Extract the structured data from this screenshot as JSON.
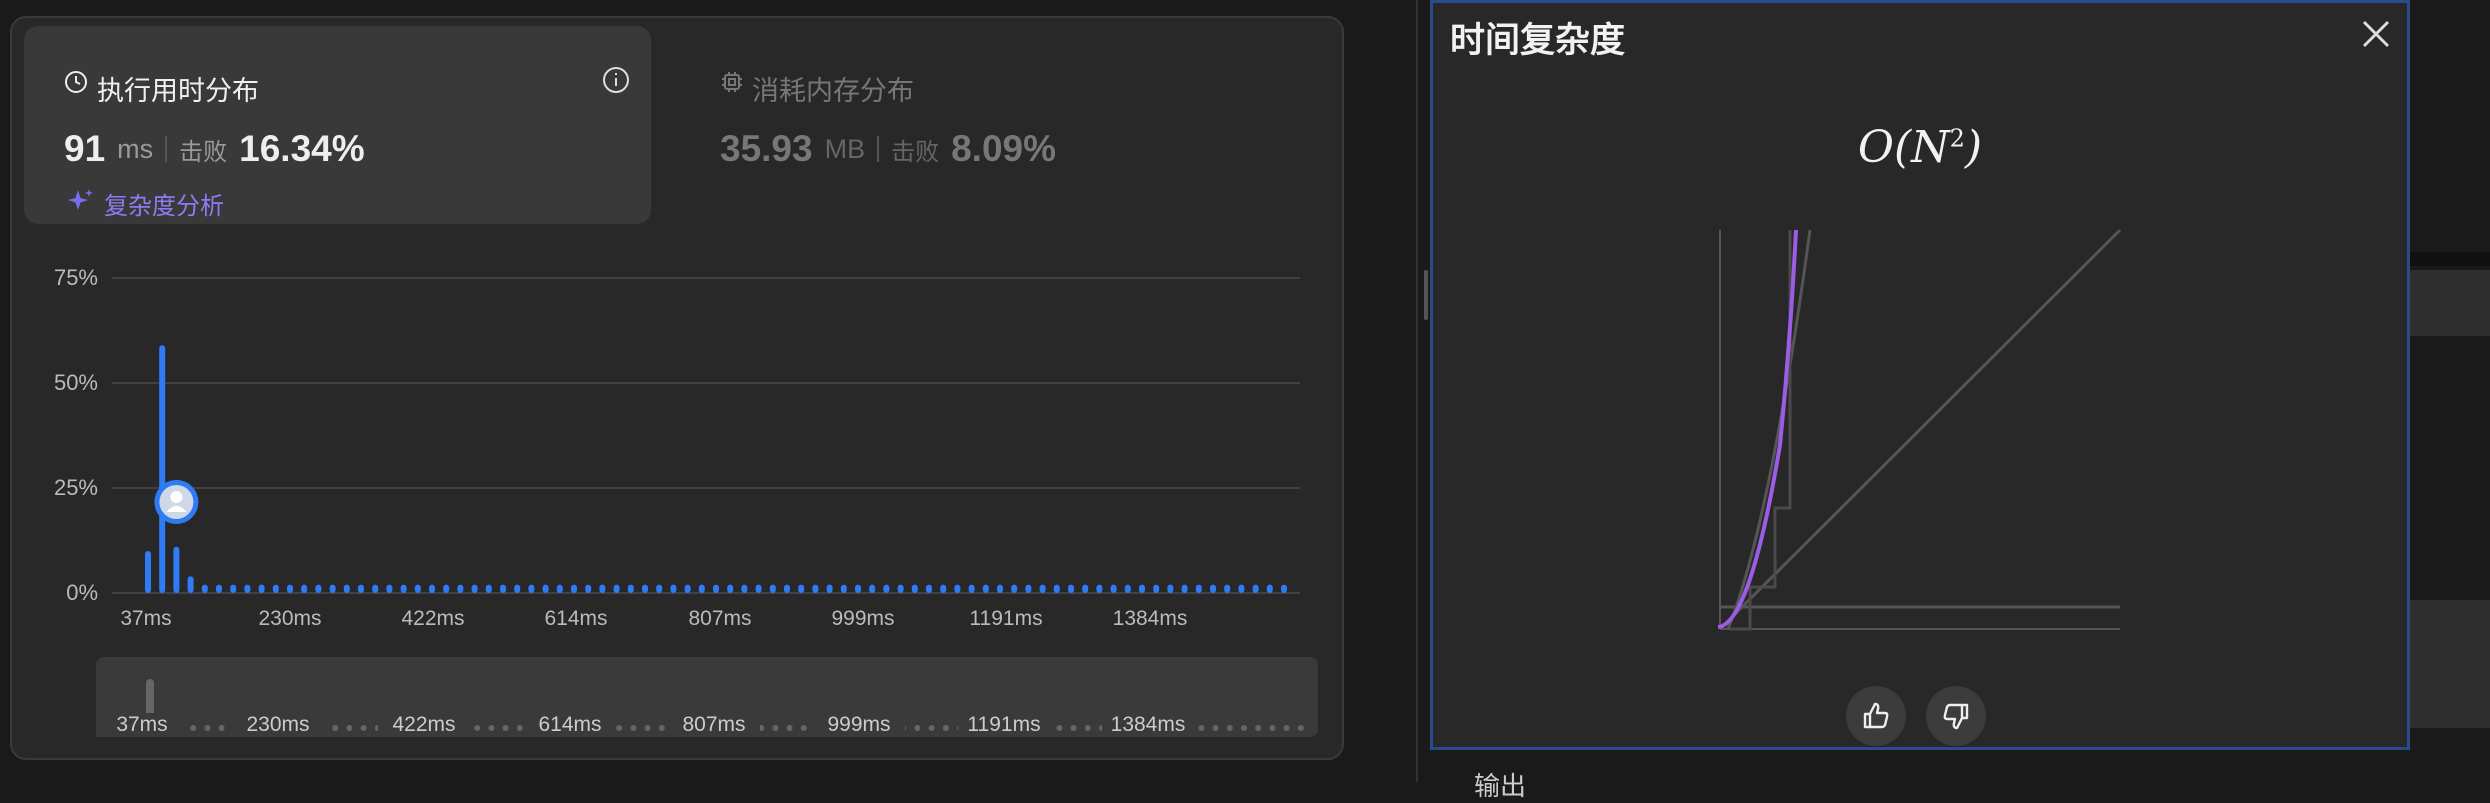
{
  "runtime": {
    "title": "执行用时分布",
    "value": "91",
    "unit": "ms",
    "beats_label": "击败",
    "beats_value": "16.34%",
    "analysis_link": "复杂度分析"
  },
  "memory": {
    "title": "消耗内存分布",
    "value": "35.93",
    "unit": "MB",
    "beats_label": "击败",
    "beats_value": "8.09%"
  },
  "chart_data": {
    "type": "bar",
    "y_ticks": [
      "75%",
      "50%",
      "25%",
      "0%"
    ],
    "x_ticks": [
      "37ms",
      "230ms",
      "422ms",
      "614ms",
      "807ms",
      "999ms",
      "1191ms",
      "1384ms"
    ],
    "ylim": [
      0,
      75
    ],
    "values": [
      10,
      59,
      11,
      4,
      2,
      2,
      2,
      2,
      2,
      2,
      2,
      2,
      2,
      2,
      2,
      2,
      2,
      2,
      2,
      2,
      2,
      2,
      2,
      2,
      2,
      2,
      2,
      2,
      2,
      2,
      2,
      2,
      2,
      2,
      2,
      2,
      2,
      2,
      2,
      2,
      2,
      2,
      2,
      2,
      2,
      2,
      2,
      2,
      2,
      2,
      2,
      2,
      2,
      2,
      2,
      2,
      2,
      2,
      2,
      2,
      2,
      2,
      2,
      2,
      2,
      2,
      2,
      2,
      2,
      2,
      2,
      2,
      2,
      2,
      2,
      2,
      2,
      2,
      2,
      2,
      2
    ],
    "bar_color": "#2f7bf5",
    "user_marker_index": 2,
    "grid": true
  },
  "range_slider": {
    "labels": [
      "37ms",
      "230ms",
      "422ms",
      "614ms",
      "807ms",
      "999ms",
      "1191ms",
      "1384ms"
    ]
  },
  "complexity_panel": {
    "title": "时间复杂度",
    "formula_base": "O(N",
    "formula_exp": "2",
    "formula_close": ")",
    "curve_color": "#9b5de5"
  },
  "bottom_text": "输出",
  "colors": {
    "accent_bar": "#2f7bf5",
    "link": "#9b7bf5",
    "panel_border": "#2a4a8a"
  }
}
